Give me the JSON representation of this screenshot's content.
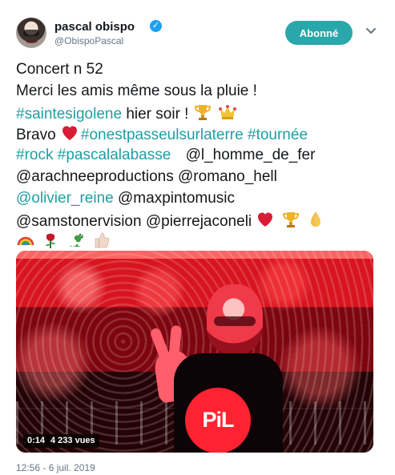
{
  "user": {
    "name": "pascal obispo",
    "handle": "@ObispoPascal",
    "verified_mark": "✓"
  },
  "actions": {
    "follow_label": "Abonné"
  },
  "tweet": {
    "line1": "Concert n 52",
    "line2": "Merci les amis même sous la pluie !",
    "hashtag_saintesigolene": "#saintesigolene",
    "line3_rest": " hier soir !",
    "line4_prefix": "Bravo ",
    "hashtag_onestpasseulsurlaterre": "#onestpasseulsurlaterre",
    "line4_space": " ",
    "hashtag_tournee": "#tournée",
    "hashtag_rock": "#rock",
    "line5_space": " ",
    "hashtag_pascalalabasse": "#pascalalabasse",
    "mention_l_homme_de_fer": "@l_homme_de_fer",
    "line6": "@arachneeproductions @romano_hell",
    "mention_olivier_reine": "@olivier_reine",
    "line7_rest": " @maxpintomusic",
    "line8": "@samstonervision @pierrejaconeli"
  },
  "emojis": {
    "trophy": "trophy-icon",
    "crown": "crown-icon",
    "heart": "heart-icon",
    "praying_hands": "praying-hands-icon",
    "rainbow": "rainbow-icon",
    "rose": "rose-icon",
    "dragon": "dragon-icon",
    "thumbs_up": "thumbs-up-icon"
  },
  "video": {
    "time": "0:14",
    "views": "4 233 vues",
    "shirt_logo": "PiL"
  },
  "meta": {
    "timestamp": "12:56 - 6 juil. 2019"
  },
  "colors": {
    "hashtag": "#1f9ea4",
    "follow_button": "#2aa7aa",
    "verified": "#1da1f2",
    "secondary_text": "#657786"
  }
}
